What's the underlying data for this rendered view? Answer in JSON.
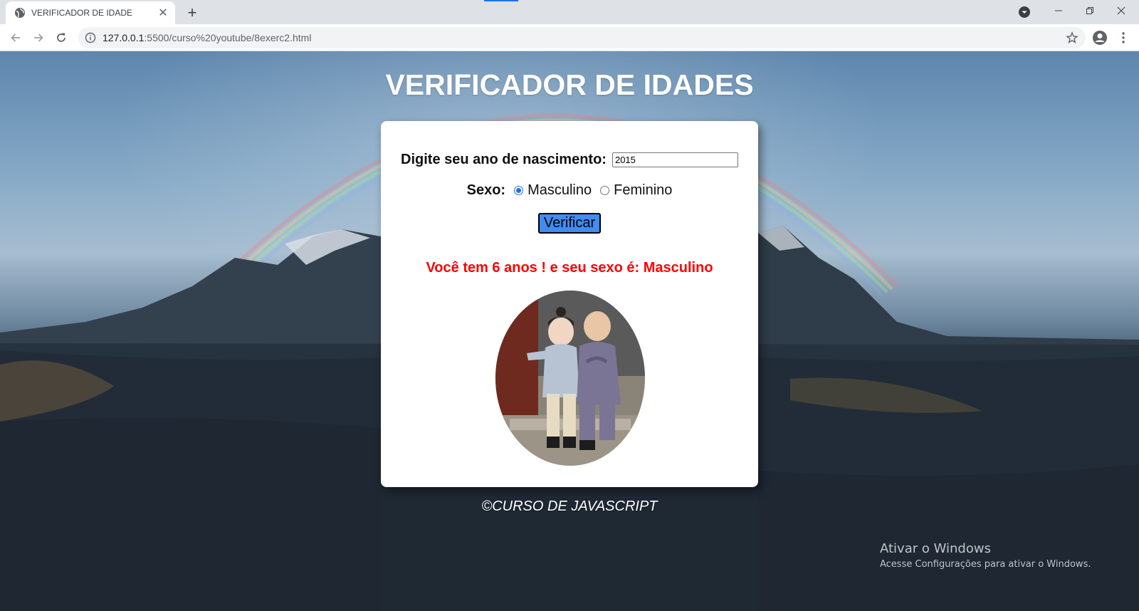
{
  "browser": {
    "tab_title": "VERIFICADOR DE IDADE",
    "new_tab_symbol": "+",
    "close_symbol": "✕",
    "url_host": "127.0.0.1",
    "url_path": ":5500/curso%20youtube/8exerc2.html"
  },
  "page": {
    "title": "VERIFICADOR DE IDADES",
    "year_label": "Digite seu ano de nascimento:",
    "year_value": "2015",
    "sex_label": "Sexo:",
    "sex_options": [
      "Masculino",
      "Feminino"
    ],
    "sex_selected": "Masculino",
    "verify_button": "Verificar",
    "result_text": "Você tem 6 anos ! e seu sexo é: Masculino",
    "footer": "©CURSO DE JAVASCRIPT"
  },
  "os_watermark": {
    "title": "Ativar o Windows",
    "subtitle": "Acesse Configurações para ativar o Windows."
  },
  "colors": {
    "button_bg": "#3f8cf2",
    "result_text": "#ff0000",
    "radio_accent": "#1a73e8"
  }
}
